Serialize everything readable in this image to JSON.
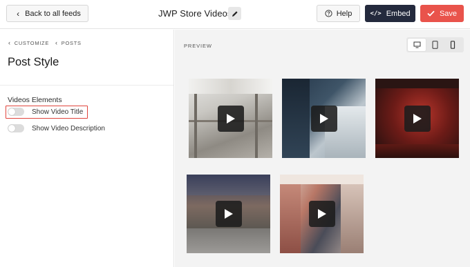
{
  "topbar": {
    "back_label": "Back to all feeds",
    "feed_title": "JWP Store Videos",
    "help_label": "Help",
    "embed_label": "Embed",
    "embed_glyph": "</>",
    "save_label": "Save"
  },
  "sidebar": {
    "breadcrumb": [
      "CUSTOMIZE",
      "POSTS"
    ],
    "title": "Post Style",
    "group_label": "Videos Elements",
    "toggles": [
      {
        "label": "Show Video Title",
        "on": false
      },
      {
        "label": "Show Video Description",
        "on": false
      }
    ]
  },
  "preview": {
    "label": "PREVIEW",
    "devices": [
      "desktop-icon",
      "tablet-icon",
      "mobile-icon"
    ],
    "active_device": "desktop",
    "videos": [
      {
        "name": "video-thumb-mall"
      },
      {
        "name": "video-thumb-workshop"
      },
      {
        "name": "video-thumb-red-store"
      },
      {
        "name": "video-thumb-street"
      },
      {
        "name": "video-thumb-clothing-rack"
      }
    ]
  },
  "colors": {
    "embed_bg": "#242a3d",
    "save_bg": "#e9534b",
    "highlight": "#e0433b",
    "preview_bg": "#f3f3f3"
  }
}
